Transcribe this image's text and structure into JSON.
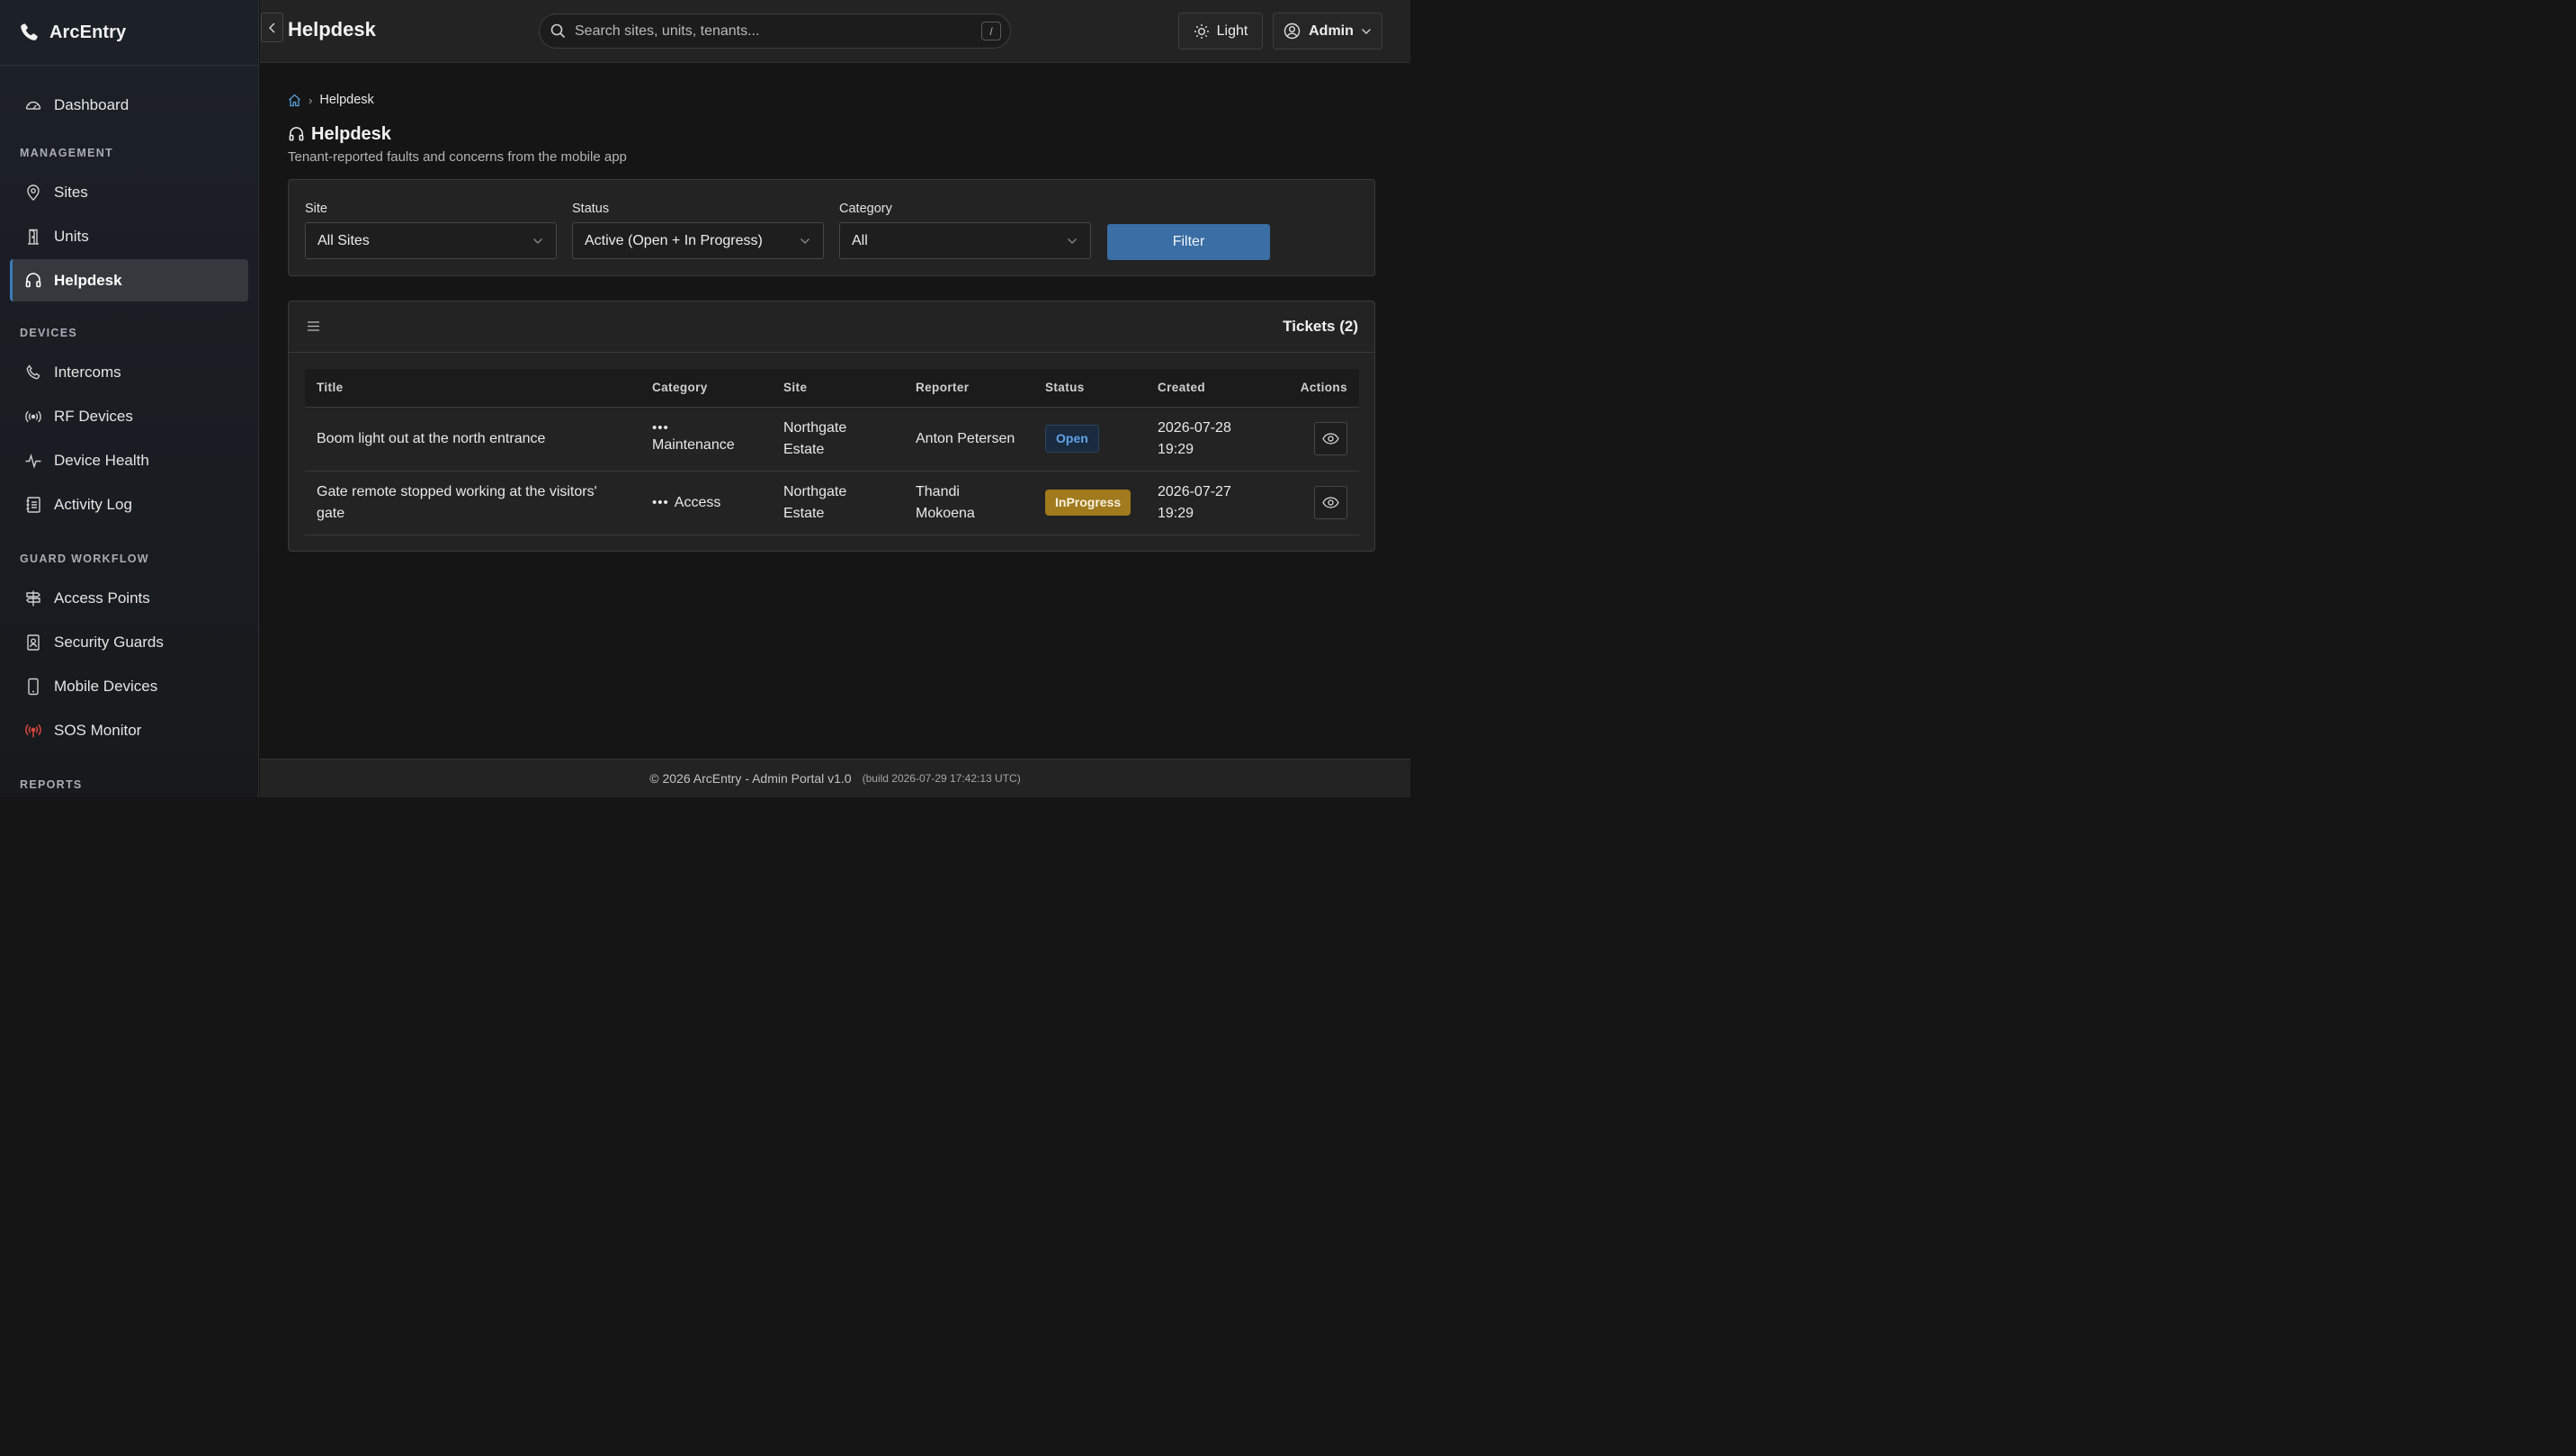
{
  "app": {
    "brand": "ArcEntry"
  },
  "sidebar": {
    "dashboard": "Dashboard",
    "sections": {
      "management": "MANAGEMENT",
      "devices": "DEVICES",
      "guard_workflow": "GUARD WORKFLOW",
      "reports": "REPORTS"
    },
    "items": {
      "sites": "Sites",
      "units": "Units",
      "helpdesk": "Helpdesk",
      "intercoms": "Intercoms",
      "rf_devices": "RF Devices",
      "device_health": "Device Health",
      "activity_log": "Activity Log",
      "access_points": "Access Points",
      "security_guards": "Security Guards",
      "mobile_devices": "Mobile Devices",
      "sos_monitor": "SOS Monitor"
    },
    "active_item": "helpdesk",
    "accent": "#3d7ab8",
    "sos_color": "#d9463c"
  },
  "topbar": {
    "title": "Helpdesk",
    "search_placeholder": "Search sites, units, tenants...",
    "search_shortcut": "/",
    "theme_label": "Light",
    "user_label": "Admin"
  },
  "breadcrumb": {
    "current": "Helpdesk"
  },
  "page": {
    "title": "Helpdesk",
    "subtitle": "Tenant-reported faults and concerns from the mobile app"
  },
  "filters": {
    "site": {
      "label": "Site",
      "value": "All Sites"
    },
    "status": {
      "label": "Status",
      "value": "Active (Open + In Progress)"
    },
    "category": {
      "label": "Category",
      "value": "All"
    },
    "submit_label": "Filter",
    "button_color": "#3a6ea4"
  },
  "tickets": {
    "header": "Tickets (2)",
    "columns": [
      "Title",
      "Category",
      "Site",
      "Reporter",
      "Status",
      "Created",
      "Actions"
    ],
    "rows": [
      {
        "title": "Boom light out at the north entrance",
        "category_icon": "•••",
        "category": "Maintenance",
        "site": "Northgate Estate",
        "reporter": "Anton Petersen",
        "status": "Open",
        "created": "2026-07-28 19:29"
      },
      {
        "title": "Gate remote stopped working at the visitors' gate",
        "category_icon": "•••",
        "category": "Access",
        "site": "Northgate Estate",
        "reporter": "Thandi Mokoena",
        "status": "InProgress",
        "created": "2026-07-27 19:29"
      }
    ],
    "status_colors": {
      "Open": "#5fa3e6",
      "InProgress": "#a07a1d"
    }
  },
  "footer": {
    "text": "© 2026 ArcEntry - Admin Portal v1.0",
    "build": "(build 2026-07-29 17:42:13 UTC)"
  }
}
